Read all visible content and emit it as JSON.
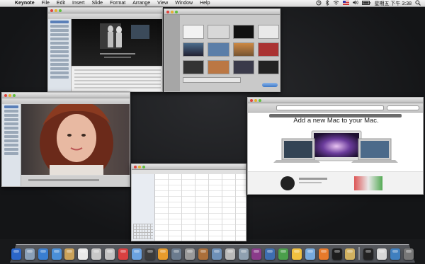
{
  "menubar": {
    "app_name": "Keynote",
    "menus": [
      "File",
      "Edit",
      "Insert",
      "Slide",
      "Format",
      "Arrange",
      "View",
      "Window",
      "Help"
    ],
    "clock": "星期五 下午 3:38"
  },
  "windows": {
    "web": {
      "headline": "Add a new Mac to your Mac."
    }
  },
  "dock": {
    "colors": [
      "#2b66c9",
      "#8aa0b8",
      "#3a7ed0",
      "#4a8fd8",
      "#caa25a",
      "#e9e9e9",
      "#c8c8c8",
      "#c2c2c2",
      "#d94040",
      "#6ba2e0",
      "#3b3b3b",
      "#e79b2c",
      "#6b7b8e",
      "#9a9a9a",
      "#ab6f3a",
      "#6e90b8",
      "#b9b9b9",
      "#8fa0b0",
      "#8a3b8a",
      "#3e6eb0",
      "#4b9f4b",
      "#f0c040",
      "#77aadd",
      "#e87a2a",
      "#1d1d1d",
      "#d0b060",
      "#222222",
      "#d8d8d8",
      "#3f7fbf",
      "#777777"
    ]
  }
}
